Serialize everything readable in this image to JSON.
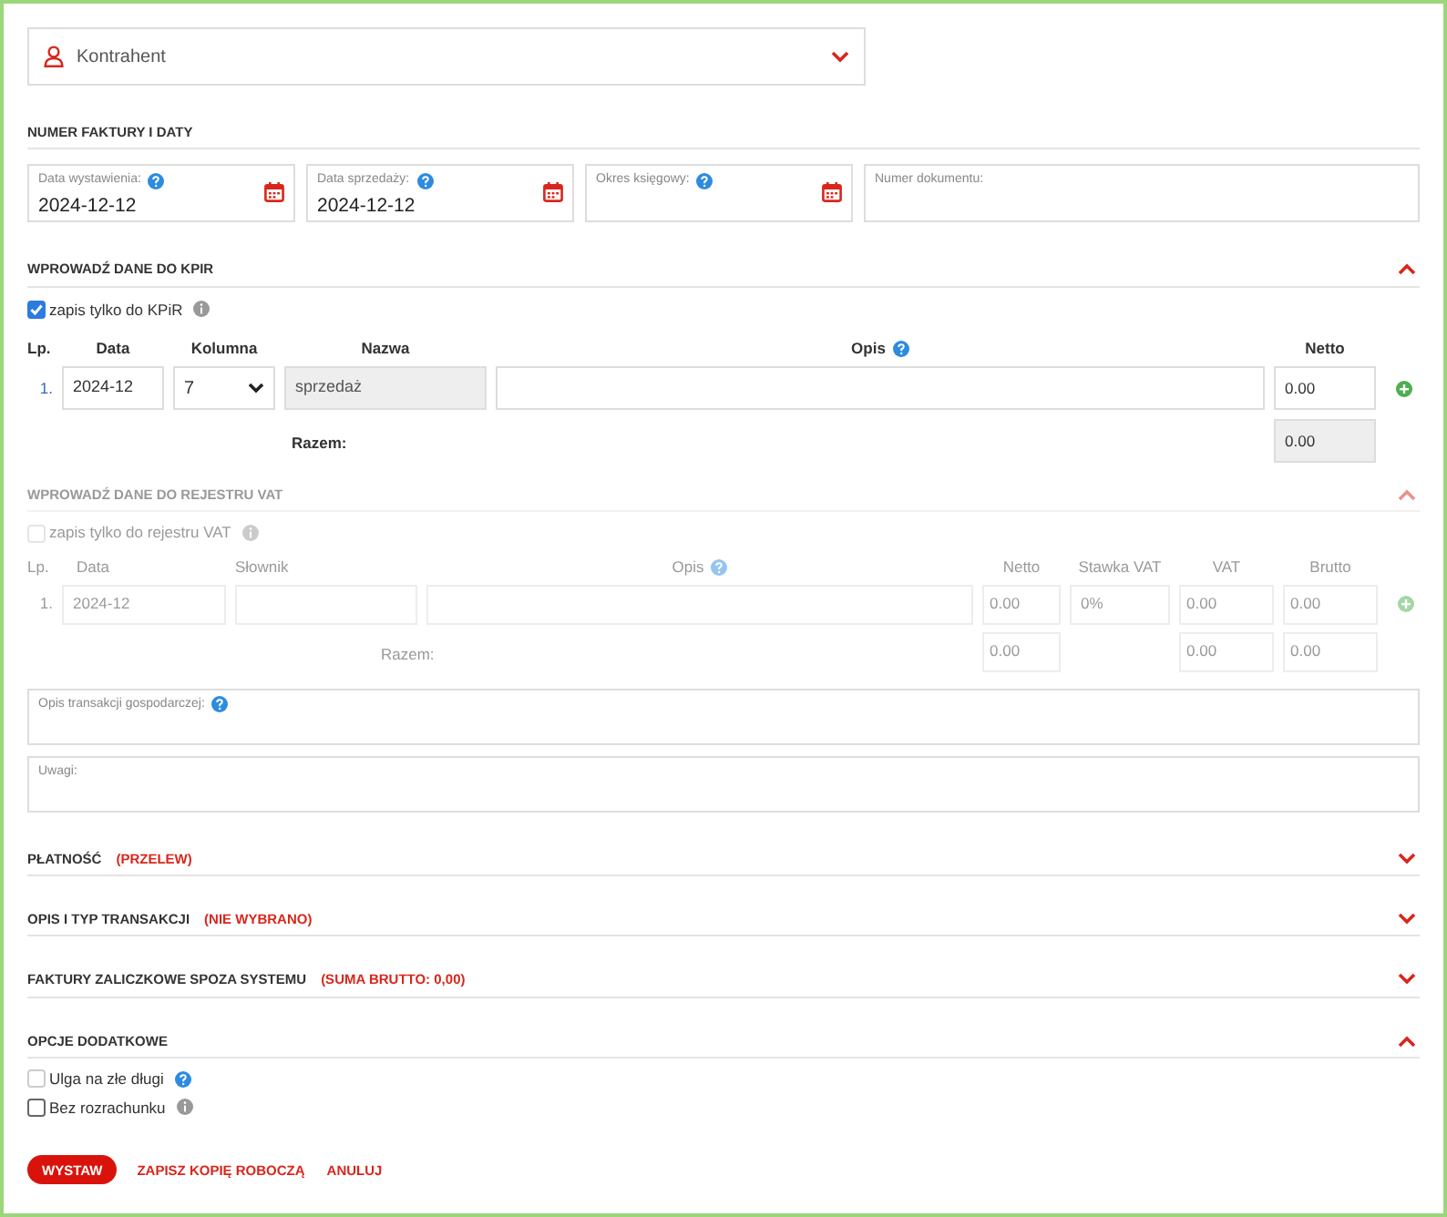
{
  "contractor": {
    "placeholder": "Kontrahent"
  },
  "dates": {
    "title": "NUMER FAKTURY I DATY",
    "fields": [
      {
        "label": "Data wystawienia:",
        "help": true,
        "calendar": true,
        "value": "2024-12-12"
      },
      {
        "label": "Data sprzedaży:",
        "help": true,
        "calendar": true,
        "value": "2024-12-12"
      },
      {
        "label": "Okres księgowy:",
        "help": true,
        "calendar": true
      },
      {
        "label": "Numer dokumentu:",
        "help": false,
        "calendar": false
      }
    ]
  },
  "kpir": {
    "title": "WPROWADŹ DANE DO KPIR",
    "expanded": true,
    "checkbox": {
      "label": "zapis tylko do KPiR",
      "checked": true
    },
    "columns": [
      "Lp.",
      "Data",
      "Kolumna",
      "Nazwa",
      "Opis",
      "Netto"
    ],
    "rows": [
      {
        "lp": "1.",
        "date": "2024-12",
        "column": "7",
        "name": "sprzedaż",
        "netto": "0.00"
      }
    ],
    "total_label": "Razem:",
    "total": "0.00"
  },
  "vat": {
    "title": "WPROWADŹ DANE DO REJESTRU VAT",
    "expanded": true,
    "disabled": true,
    "checkbox": {
      "label": "zapis tylko do rejestru VAT",
      "checked": false
    },
    "columns": [
      "Lp.",
      "Data",
      "Słownik",
      "Opis",
      "Netto",
      "Stawka VAT",
      "VAT",
      "Brutto"
    ],
    "rows": [
      {
        "lp": "1.",
        "date": "2024-12",
        "netto": "0.00",
        "rate": "0%",
        "vat": "0.00",
        "brutto": "0.00"
      }
    ],
    "total_label": "Razem:",
    "totals": {
      "netto": "0.00",
      "vat": "0.00",
      "brutto": "0.00"
    }
  },
  "textareas": [
    {
      "label": "Opis transakcji gospodarczej:",
      "help": true
    },
    {
      "label": "Uwagi:",
      "help": false
    }
  ],
  "collapsed_sections": [
    {
      "title": "PŁATNOŚĆ",
      "note": "(PRZELEW)",
      "expanded": false
    },
    {
      "title": "OPIS I TYP TRANSAKCJI",
      "note": "(NIE WYBRANO)",
      "expanded": false
    },
    {
      "title": "FAKTURY ZALICZKOWE SPOZA SYSTEMU",
      "note": "(SUMA BRUTTO: 0,00)",
      "expanded": false
    }
  ],
  "options": {
    "title": "OPCJE DODATKOWE",
    "expanded": true,
    "items": [
      {
        "label": "Ulga na złe długi",
        "checked": false,
        "disabled": true,
        "help": true
      },
      {
        "label": "Bez rozrachunku",
        "checked": false,
        "disabled": false,
        "help": false
      }
    ]
  },
  "buttons": [
    {
      "label": "WYSTAW",
      "kind": "primary"
    },
    {
      "label": "ZAPISZ KOPIĘ ROBOCZĄ",
      "kind": "link"
    },
    {
      "label": "ANULUJ",
      "kind": "link"
    }
  ]
}
